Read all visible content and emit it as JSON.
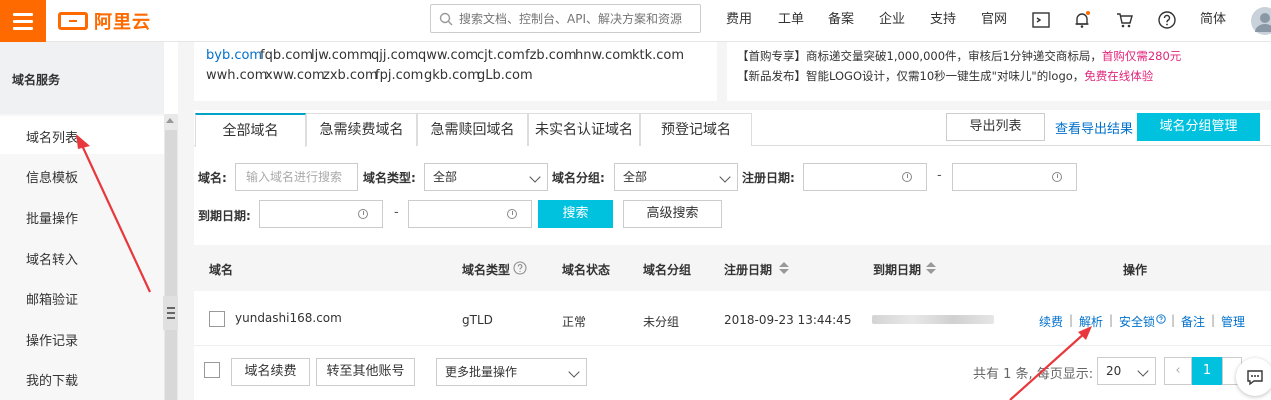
{
  "header": {
    "logo_text": "阿里云",
    "search_placeholder": "搜索文档、控制台、API、解决方案和资源",
    "nav": [
      "费用",
      "工单",
      "备案",
      "企业",
      "支持",
      "官网"
    ],
    "lang": "简体",
    "accent": "#ff6a00"
  },
  "sidebar": {
    "title": "域名服务",
    "items": [
      "域名列表",
      "信息模板",
      "批量操作",
      "域名转入",
      "邮箱验证",
      "操作记录",
      "我的下载"
    ]
  },
  "promo": {
    "domains_row1": [
      "byb.com",
      "fqb.com",
      "ljw.comm",
      "qjj.com",
      "qww.com",
      "cjt.com",
      "fzb.com",
      "hnw.com",
      "ktk.com"
    ],
    "domains_row2": [
      "wwh.com",
      "xww.com",
      "zxb.com",
      "fpj.com",
      "gkb.com",
      "gLb.com"
    ],
    "notice1_prefix": "【首购专享】商标递交量突破1,000,000件，审核后1分钟递交商标局，",
    "notice1_highlight": "首购仅需280元",
    "notice2_prefix": "【新品发布】智能LOGO设计，仅需10秒一键生成\"对味儿\"的logo，",
    "notice2_highlight": "免费在线体验"
  },
  "tabs": [
    "全部域名",
    "急需续费域名",
    "急需赎回域名",
    "未实名认证域名",
    "预登记域名"
  ],
  "toolbar": {
    "export": "导出列表",
    "view_export": "查看导出结果",
    "group_manage": "域名分组管理"
  },
  "filters": {
    "domain_label": "域名:",
    "domain_placeholder": "输入域名进行搜索",
    "type_label": "域名类型:",
    "type_value": "全部",
    "group_label": "域名分组:",
    "group_value": "全部",
    "reg_date_label": "注册日期:",
    "exp_date_label": "到期日期:",
    "dash": "-",
    "search_btn": "搜索",
    "advanced_btn": "高级搜索"
  },
  "table": {
    "headers": [
      "域名",
      "域名类型",
      "域名状态",
      "域名分组",
      "注册日期",
      "到期日期",
      "操作"
    ],
    "rows": [
      {
        "domain": "yundashi168.com",
        "type": "gTLD",
        "status": "正常",
        "group": "未分组",
        "reg_date": "2018-09-23 13:44:45",
        "actions": [
          "续费",
          "解析",
          "安全锁",
          "备注",
          "管理"
        ]
      }
    ]
  },
  "footer": {
    "renew_btn": "域名续费",
    "transfer_btn": "转至其他账号",
    "more_ops": "更多批量操作",
    "total_text": "共有 1 条, 每页显示:",
    "page_size": "20",
    "prev": "‹",
    "current_page": "1"
  }
}
